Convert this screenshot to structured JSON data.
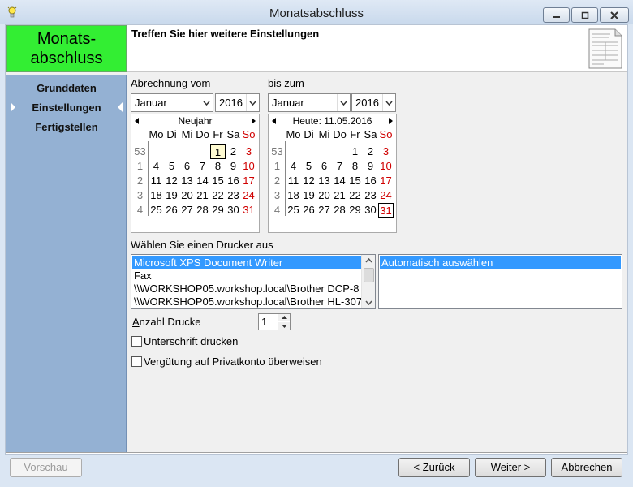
{
  "window": {
    "title": "Monatsabschluss"
  },
  "header": {
    "badge_line1": "Monats-",
    "badge_line2": "abschluss",
    "text": "Treffen Sie hier weitere Einstellungen"
  },
  "nav": {
    "items": [
      "Grunddaten",
      "Einstellungen",
      "Fertigstellen"
    ],
    "active": "Einstellungen"
  },
  "from": {
    "label": "Abrechnung vom",
    "month": "Januar",
    "year": "2016",
    "caption": "Neujahr"
  },
  "to": {
    "label": "bis zum",
    "month": "Januar",
    "year": "2016",
    "caption": "Heute: 11.05.2016"
  },
  "calendar": {
    "weekdays": [
      "Mo",
      "Di",
      "Mi",
      "Do",
      "Fr",
      "Sa",
      "So"
    ],
    "weeks": [
      "53",
      "1",
      "2",
      "3",
      "4"
    ],
    "rows": [
      [
        "",
        "",
        "",
        "",
        "1",
        "2",
        "3"
      ],
      [
        "4",
        "5",
        "6",
        "7",
        "8",
        "9",
        "10"
      ],
      [
        "11",
        "12",
        "13",
        "14",
        "15",
        "16",
        "17"
      ],
      [
        "18",
        "19",
        "20",
        "21",
        "22",
        "23",
        "24"
      ],
      [
        "25",
        "26",
        "27",
        "28",
        "29",
        "30",
        "31"
      ]
    ],
    "from_selected": "1",
    "to_selected": "31"
  },
  "printer": {
    "label": "Wählen Sie einen Drucker aus",
    "options": [
      "Microsoft XPS Document Writer",
      "Fax",
      "\\\\WORKSHOP05.workshop.local\\Brother DCP-8",
      "\\\\WORKSHOP05.workshop.local\\Brother HL-307"
    ],
    "selected": "Microsoft XPS Document Writer",
    "tray": "Automatisch auswählen"
  },
  "copies": {
    "label": "Anzahl Drucke",
    "value": "1"
  },
  "options": {
    "signature": {
      "label": "Unterschrift drucken",
      "checked": false
    },
    "private": {
      "label": "Vergütung auf Privatkonto überweisen",
      "checked": false
    }
  },
  "buttons": {
    "preview": "Vorschau",
    "back": "< Zurück",
    "next": "Weiter >",
    "cancel": "Abbrechen"
  },
  "colors": {
    "badge": "#33ee33",
    "sidebar": "#94b1d3",
    "selection": "#3399ff",
    "weekend": "#d00000"
  }
}
